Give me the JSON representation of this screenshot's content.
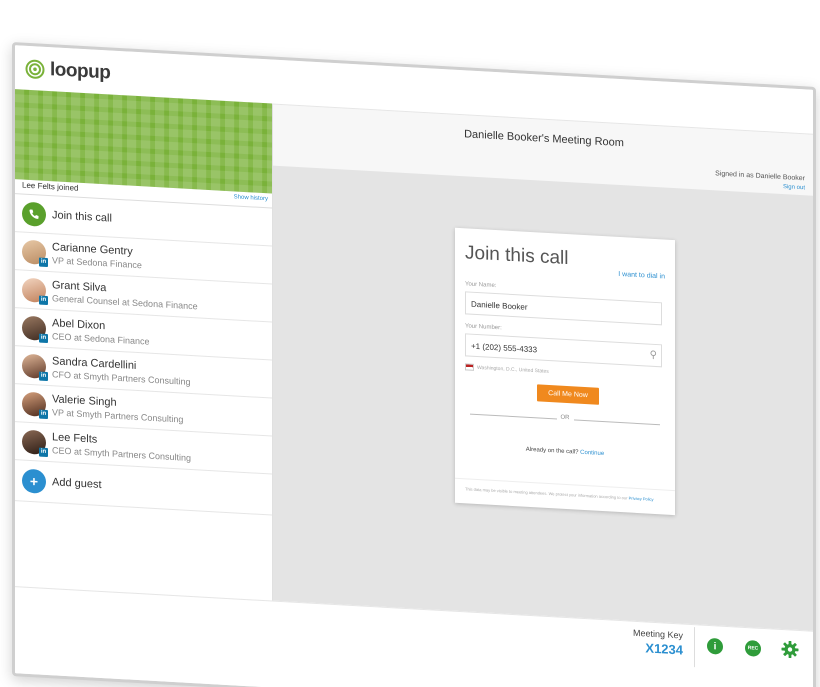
{
  "app": {
    "logo_text": "loopup"
  },
  "header": {
    "room_title": "Danielle Booker's Meeting Room",
    "signed_in": "Signed in as Danielle Booker",
    "sign_out": "Sign out"
  },
  "sidebar": {
    "joined_text": "Lee Felts joined",
    "show_history": "Show history",
    "join_call_label": "Join this call",
    "participants": [
      {
        "name": "Carianne Gentry",
        "title": "VP at Sedona Finance"
      },
      {
        "name": "Grant Silva",
        "title": "General Counsel at Sedona Finance"
      },
      {
        "name": "Abel Dixon",
        "title": "CEO at Sedona Finance"
      },
      {
        "name": "Sandra Cardellini",
        "title": "CFO at Smyth Partners Consulting"
      },
      {
        "name": "Valerie Singh",
        "title": "VP at Smyth Partners Consulting"
      },
      {
        "name": "Lee Felts",
        "title": "CEO at Smyth Partners Consulting"
      }
    ],
    "linkedin_badge": "in",
    "add_guest_label": "Add guest"
  },
  "join_card": {
    "title": "Join this call",
    "dial_in_link": "I want to dial in",
    "name_label": "Your Name:",
    "name_value": "Danielle Booker",
    "number_label": "Your Number:",
    "number_value": "+1 (202) 555-4333",
    "location": "Washington, D.C., United States",
    "call_button": "Call Me Now",
    "or_text": "OR",
    "already_text": "Already on the call?",
    "continue_link": "Continue",
    "footer_text": "This data may be visible to meeting attendees. We protect your information according to our",
    "privacy_link": "Privacy Policy"
  },
  "bottombar": {
    "meeting_key_label": "Meeting Key",
    "meeting_key_value": "X1234",
    "info_icon": "info-icon",
    "rec_label": "REC",
    "settings_icon": "gear-icon"
  },
  "colors": {
    "brand_green": "#7ab23a",
    "accent_blue": "#2b8fd0",
    "call_orange": "#f0891e",
    "tool_green": "#2f9c3a"
  }
}
